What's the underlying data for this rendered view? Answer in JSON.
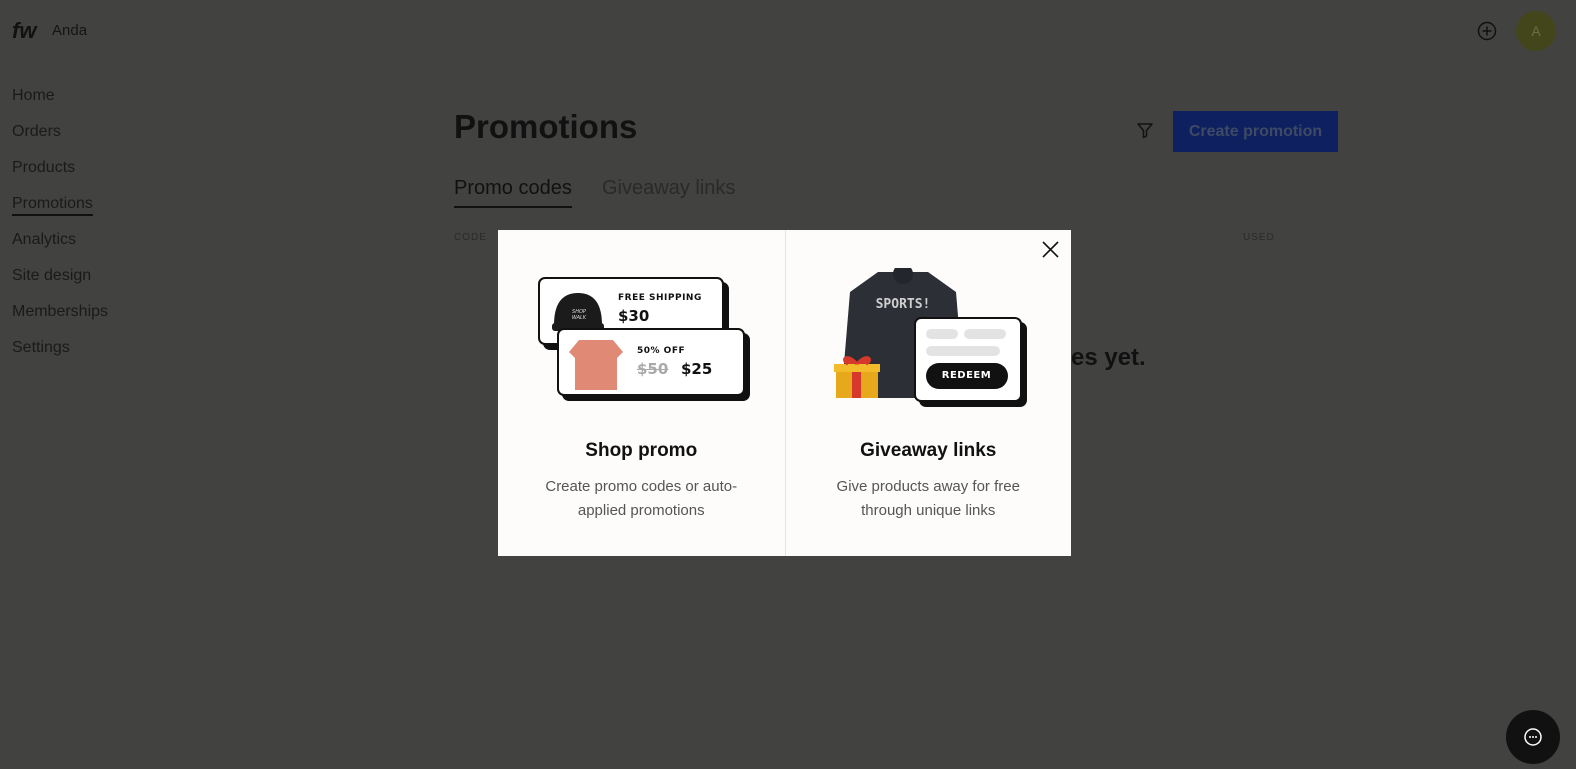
{
  "header": {
    "logo": "fw",
    "store_name": "Anda",
    "avatar_initial": "A"
  },
  "sidebar": {
    "items": [
      {
        "label": "Home"
      },
      {
        "label": "Orders"
      },
      {
        "label": "Products"
      },
      {
        "label": "Promotions",
        "active": true
      },
      {
        "label": "Analytics"
      },
      {
        "label": "Site design"
      },
      {
        "label": "Memberships"
      },
      {
        "label": "Settings"
      }
    ]
  },
  "main": {
    "title": "Promotions",
    "create_label": "Create promotion",
    "tabs": [
      {
        "label": "Promo codes",
        "active": true
      },
      {
        "label": "Giveaway links"
      }
    ],
    "columns": [
      "CODE",
      "USED"
    ],
    "empty_text_visible": "es yet."
  },
  "modal": {
    "shop": {
      "title": "Shop promo",
      "desc": "Create promo codes or auto-applied promotions",
      "card1_label": "FREE SHIPPING",
      "card1_price": "$30",
      "card2_label": "50% OFF",
      "card2_old": "$50",
      "card2_new": "$25",
      "cap_text": "SHOP WALK"
    },
    "giveaway": {
      "title": "Giveaway links",
      "desc": "Give products away for free through unique links",
      "shirt_text": "SPORTS!",
      "redeem": "REDEEM"
    }
  },
  "colors": {
    "accent": "#0e2060",
    "overlay": "#424241",
    "modal_bg": "#fdfcfa"
  }
}
